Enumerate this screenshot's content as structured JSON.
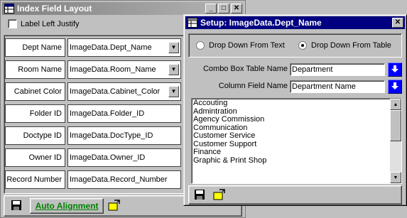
{
  "index_window": {
    "title": "Index Field Layout",
    "controls": {
      "minimize": "_",
      "maximize": "□",
      "close": "✕"
    },
    "label_left_justify": {
      "label": "Label Left Justify",
      "checked": false
    },
    "fields": [
      {
        "label": "Dept Name",
        "value": "ImageData.Dept_Name",
        "has_dropdown": true
      },
      {
        "label": "Room Name",
        "value": "ImageData.Room_Name",
        "has_dropdown": true
      },
      {
        "label": "Cabinet Color",
        "value": "ImageData.Cabinet_Color",
        "has_dropdown": true
      },
      {
        "label": "Folder ID",
        "value": "ImageData.Folder_ID",
        "has_dropdown": false
      },
      {
        "label": "Doctype ID",
        "value": "ImageData.DocType_ID",
        "has_dropdown": false
      },
      {
        "label": "Owner ID",
        "value": "ImageData.Owner_ID",
        "has_dropdown": false
      },
      {
        "label": "Record Number",
        "value": "ImageData.Record_Number",
        "has_dropdown": false
      }
    ],
    "toolbar": {
      "auto_alignment_label": "Auto Alignment",
      "icons": [
        "save-icon",
        "exit-icon"
      ]
    }
  },
  "setup_dialog": {
    "title": "Setup: ImageData.Dept_Name",
    "close": "✕",
    "radio_text": {
      "label": "Drop Down From Text",
      "selected": false
    },
    "radio_table": {
      "label": "Drop Down From Table",
      "selected": true
    },
    "combo_table_label": "Combo Box Table Name",
    "combo_table_value": "Department",
    "column_field_label": "Column Field Name",
    "column_field_value": "Department Name",
    "list_items": [
      "Accouting",
      "Admintration",
      "Agency Commission",
      "Communication",
      "Customer Service",
      "Customer Support",
      "Finance",
      "Graphic & Print Shop"
    ],
    "toolbar_icons": [
      "save-icon",
      "exit-icon"
    ]
  },
  "colors": {
    "active_title": "#000080",
    "inactive_title": "#808080",
    "auto_alignment_text": "#008000",
    "blue_button": "#0000ff"
  }
}
